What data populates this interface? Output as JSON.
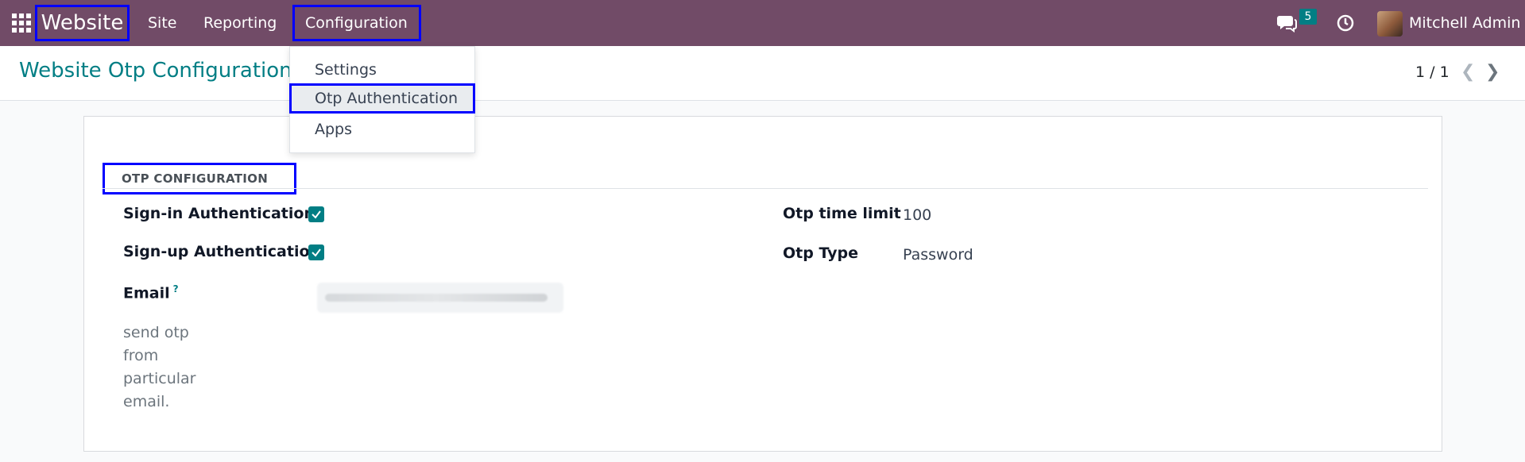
{
  "navbar": {
    "brand": "Website",
    "menu": [
      "Site",
      "Reporting",
      "Configuration"
    ],
    "chat_count": "5",
    "user_name": "Mitchell Admin",
    "icons": [
      "apps-grid-icon",
      "chat-icon",
      "clock-icon"
    ]
  },
  "dropdown": {
    "items": [
      "Settings",
      "Otp Authentication",
      "Apps"
    ]
  },
  "control_panel": {
    "title": "Website Otp Configuration",
    "title_tail": "n",
    "pager": "1 / 1"
  },
  "form": {
    "section_title": "OTP CONFIGURATION",
    "signin_label": "Sign-in Authentication",
    "signin_checked": true,
    "signup_label": "Sign-up Authentication",
    "signup_checked": true,
    "email_label": "Email",
    "email_help_mark": "?",
    "help_text": "send otp from particular email.",
    "otp_time_limit_label": "Otp time limit",
    "otp_time_limit_value": "100",
    "otp_type_label": "Otp Type",
    "otp_type_value": "Password"
  },
  "colors": {
    "navbar": "#714b67",
    "accent": "#017e84",
    "highlight_border": "#0000ff"
  }
}
